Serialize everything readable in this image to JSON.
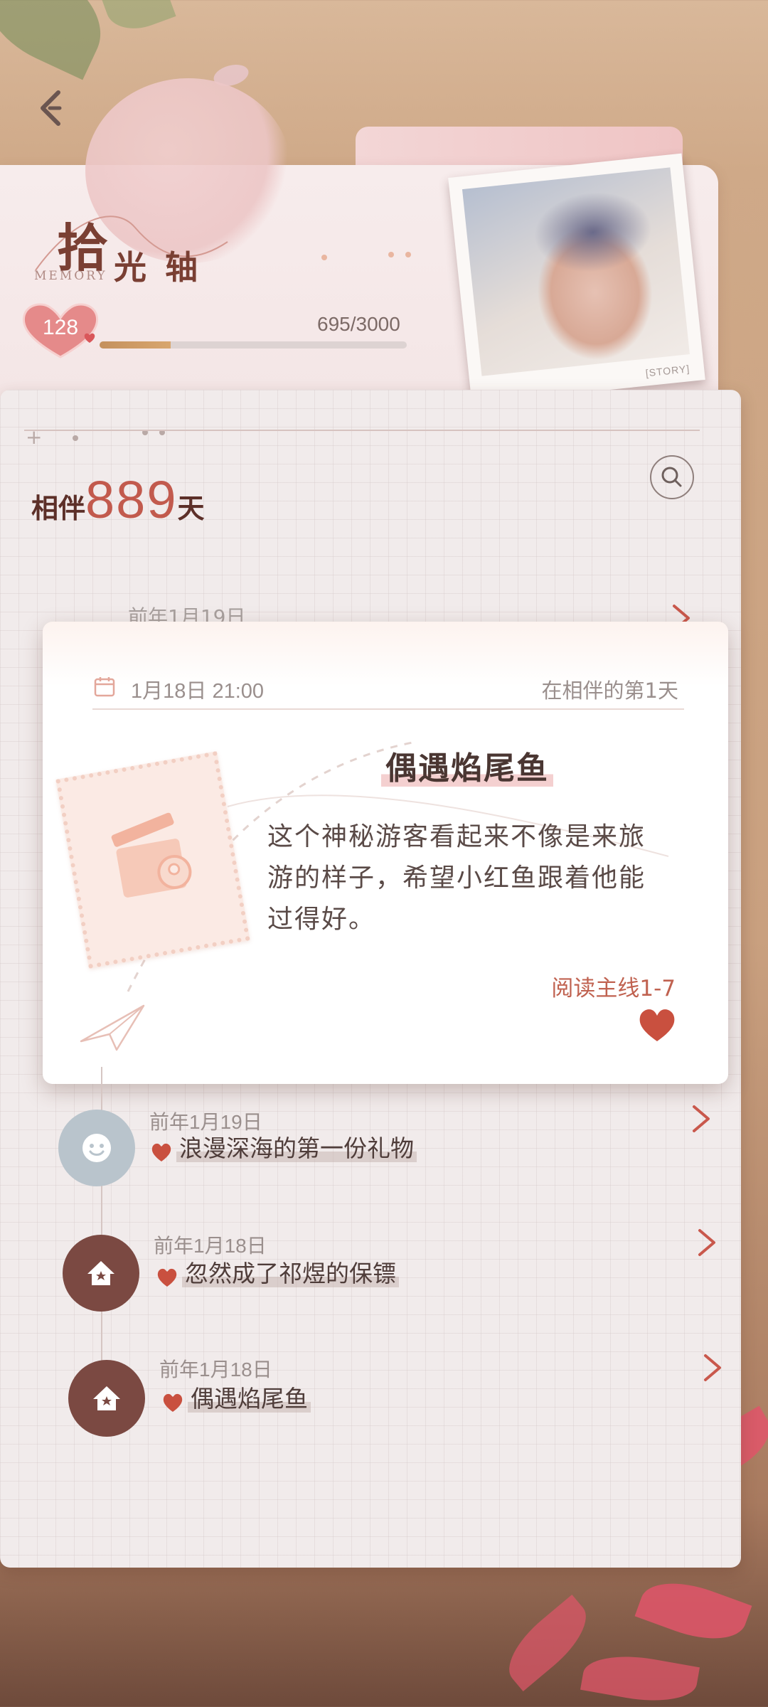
{
  "header": {
    "title_main": "拾",
    "title_sub": "光轴",
    "title_en": "MEMORY",
    "level": "128",
    "progress_text": "695/3000",
    "progress_fraction": 0.2317,
    "photo_label": "[STORY]"
  },
  "companion": {
    "prefix": "相伴",
    "days": "889",
    "suffix": "天"
  },
  "hidden_row": {
    "date": "前年1月19日"
  },
  "popup": {
    "datetime": "1月18日 21:00",
    "day_label": "在相伴的第1天",
    "title": "偶遇焰尾鱼",
    "body": "这个神秘游客看起来不像是来旅游的样子，希望小红鱼跟着他能过得好。",
    "link": "阅读主线1-7"
  },
  "timeline": [
    {
      "date": "前年1月19日",
      "title": "浪漫深海的第一份礼物",
      "icon": "smiley-icon",
      "color": "#b9c4cc"
    },
    {
      "date": "前年1月18日",
      "title": "忽然成了祁煜的保镖",
      "icon": "home-icon",
      "color": "#7b4942"
    },
    {
      "date": "前年1月18日",
      "title": "偶遇焰尾鱼",
      "icon": "home-icon",
      "color": "#7b4942"
    }
  ],
  "colors": {
    "accent": "#c25a4d",
    "heart": "#c9503f",
    "dark_brown": "#7b4942"
  }
}
